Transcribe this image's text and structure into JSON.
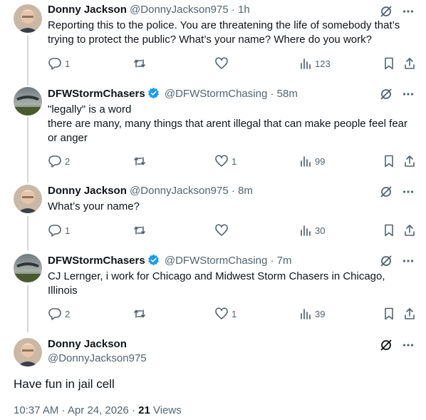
{
  "tweets": [
    {
      "name": "Donny Jackson",
      "handle": "@DonnyJackson975",
      "time": "· 1h",
      "verified": false,
      "text": "Reporting this to the police. You are threatening the life of somebody that’s trying to protect the public? What’s your name? Where do you work?",
      "replies": "1",
      "reposts": "",
      "likes": "",
      "views": "123"
    },
    {
      "name": "DFWStormChasers",
      "handle": "@DFWStormChasing",
      "time": "· 58m",
      "verified": true,
      "text": "\"legally\" is a word\nthere are many, many things that arent illegal that can make people feel fear or anger",
      "replies": "2",
      "reposts": "",
      "likes": "1",
      "views": "99"
    },
    {
      "name": "Donny Jackson",
      "handle": "@DonnyJackson975",
      "time": "· 8m",
      "verified": false,
      "text": "What’s your name?",
      "replies": "1",
      "reposts": "",
      "likes": "",
      "views": "30"
    },
    {
      "name": "DFWStormChasers",
      "handle": "@DFWStormChasing",
      "time": "· 7m",
      "verified": true,
      "text": "CJ Lernger, i work for Chicago and Midwest Storm Chasers in Chicago, Illinois",
      "replies": "2",
      "reposts": "",
      "likes": "1",
      "views": "39"
    }
  ],
  "main": {
    "name": "Donny Jackson",
    "handle": "@DonnyJackson975",
    "text": "Have fun in jail cell",
    "time": "10:37 AM · Apr 24, 2026 ·",
    "views_count": "21",
    "views_label": "Views"
  },
  "colors": {
    "verified": "#1d9bf0",
    "secondary_text": "#536471",
    "rail": "#cfd9de"
  },
  "icons": [
    "grok-icon",
    "more-icon",
    "reply-icon",
    "repost-icon",
    "like-icon",
    "views-icon",
    "bookmark-icon",
    "share-icon",
    "verified-badge-icon"
  ]
}
